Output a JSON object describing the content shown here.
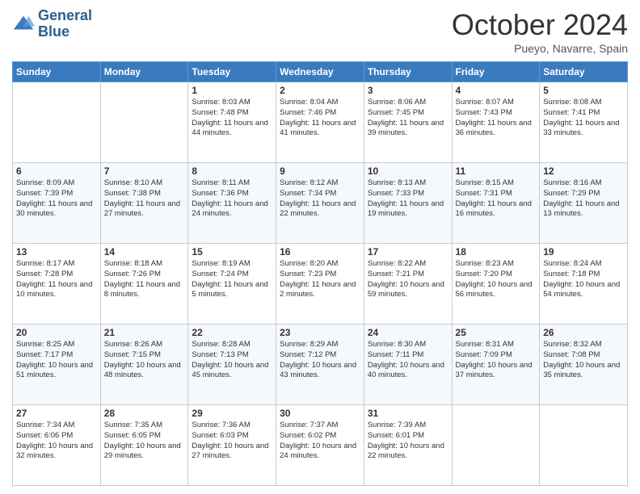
{
  "header": {
    "logo_line1": "General",
    "logo_line2": "Blue",
    "month": "October 2024",
    "location": "Pueyo, Navarre, Spain"
  },
  "weekdays": [
    "Sunday",
    "Monday",
    "Tuesday",
    "Wednesday",
    "Thursday",
    "Friday",
    "Saturday"
  ],
  "weeks": [
    [
      {
        "day": "",
        "info": ""
      },
      {
        "day": "",
        "info": ""
      },
      {
        "day": "1",
        "info": "Sunrise: 8:03 AM\nSunset: 7:48 PM\nDaylight: 11 hours and 44 minutes."
      },
      {
        "day": "2",
        "info": "Sunrise: 8:04 AM\nSunset: 7:46 PM\nDaylight: 11 hours and 41 minutes."
      },
      {
        "day": "3",
        "info": "Sunrise: 8:06 AM\nSunset: 7:45 PM\nDaylight: 11 hours and 39 minutes."
      },
      {
        "day": "4",
        "info": "Sunrise: 8:07 AM\nSunset: 7:43 PM\nDaylight: 11 hours and 36 minutes."
      },
      {
        "day": "5",
        "info": "Sunrise: 8:08 AM\nSunset: 7:41 PM\nDaylight: 11 hours and 33 minutes."
      }
    ],
    [
      {
        "day": "6",
        "info": "Sunrise: 8:09 AM\nSunset: 7:39 PM\nDaylight: 11 hours and 30 minutes."
      },
      {
        "day": "7",
        "info": "Sunrise: 8:10 AM\nSunset: 7:38 PM\nDaylight: 11 hours and 27 minutes."
      },
      {
        "day": "8",
        "info": "Sunrise: 8:11 AM\nSunset: 7:36 PM\nDaylight: 11 hours and 24 minutes."
      },
      {
        "day": "9",
        "info": "Sunrise: 8:12 AM\nSunset: 7:34 PM\nDaylight: 11 hours and 22 minutes."
      },
      {
        "day": "10",
        "info": "Sunrise: 8:13 AM\nSunset: 7:33 PM\nDaylight: 11 hours and 19 minutes."
      },
      {
        "day": "11",
        "info": "Sunrise: 8:15 AM\nSunset: 7:31 PM\nDaylight: 11 hours and 16 minutes."
      },
      {
        "day": "12",
        "info": "Sunrise: 8:16 AM\nSunset: 7:29 PM\nDaylight: 11 hours and 13 minutes."
      }
    ],
    [
      {
        "day": "13",
        "info": "Sunrise: 8:17 AM\nSunset: 7:28 PM\nDaylight: 11 hours and 10 minutes."
      },
      {
        "day": "14",
        "info": "Sunrise: 8:18 AM\nSunset: 7:26 PM\nDaylight: 11 hours and 8 minutes."
      },
      {
        "day": "15",
        "info": "Sunrise: 8:19 AM\nSunset: 7:24 PM\nDaylight: 11 hours and 5 minutes."
      },
      {
        "day": "16",
        "info": "Sunrise: 8:20 AM\nSunset: 7:23 PM\nDaylight: 11 hours and 2 minutes."
      },
      {
        "day": "17",
        "info": "Sunrise: 8:22 AM\nSunset: 7:21 PM\nDaylight: 10 hours and 59 minutes."
      },
      {
        "day": "18",
        "info": "Sunrise: 8:23 AM\nSunset: 7:20 PM\nDaylight: 10 hours and 56 minutes."
      },
      {
        "day": "19",
        "info": "Sunrise: 8:24 AM\nSunset: 7:18 PM\nDaylight: 10 hours and 54 minutes."
      }
    ],
    [
      {
        "day": "20",
        "info": "Sunrise: 8:25 AM\nSunset: 7:17 PM\nDaylight: 10 hours and 51 minutes."
      },
      {
        "day": "21",
        "info": "Sunrise: 8:26 AM\nSunset: 7:15 PM\nDaylight: 10 hours and 48 minutes."
      },
      {
        "day": "22",
        "info": "Sunrise: 8:28 AM\nSunset: 7:13 PM\nDaylight: 10 hours and 45 minutes."
      },
      {
        "day": "23",
        "info": "Sunrise: 8:29 AM\nSunset: 7:12 PM\nDaylight: 10 hours and 43 minutes."
      },
      {
        "day": "24",
        "info": "Sunrise: 8:30 AM\nSunset: 7:11 PM\nDaylight: 10 hours and 40 minutes."
      },
      {
        "day": "25",
        "info": "Sunrise: 8:31 AM\nSunset: 7:09 PM\nDaylight: 10 hours and 37 minutes."
      },
      {
        "day": "26",
        "info": "Sunrise: 8:32 AM\nSunset: 7:08 PM\nDaylight: 10 hours and 35 minutes."
      }
    ],
    [
      {
        "day": "27",
        "info": "Sunrise: 7:34 AM\nSunset: 6:06 PM\nDaylight: 10 hours and 32 minutes."
      },
      {
        "day": "28",
        "info": "Sunrise: 7:35 AM\nSunset: 6:05 PM\nDaylight: 10 hours and 29 minutes."
      },
      {
        "day": "29",
        "info": "Sunrise: 7:36 AM\nSunset: 6:03 PM\nDaylight: 10 hours and 27 minutes."
      },
      {
        "day": "30",
        "info": "Sunrise: 7:37 AM\nSunset: 6:02 PM\nDaylight: 10 hours and 24 minutes."
      },
      {
        "day": "31",
        "info": "Sunrise: 7:39 AM\nSunset: 6:01 PM\nDaylight: 10 hours and 22 minutes."
      },
      {
        "day": "",
        "info": ""
      },
      {
        "day": "",
        "info": ""
      }
    ]
  ]
}
